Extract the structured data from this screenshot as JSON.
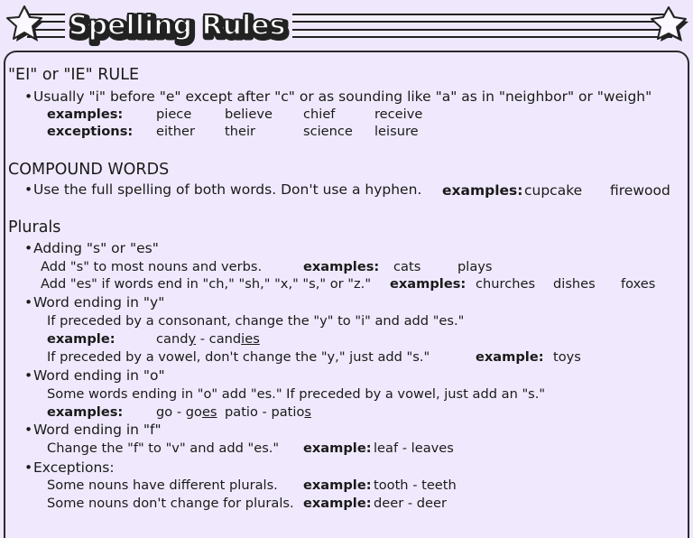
{
  "title": "Spelling Rules",
  "colors": {
    "background": "#efe8fc",
    "panel": "#f0e9fd",
    "ink": "#1a1a1a"
  },
  "sections": {
    "ei_ie": {
      "heading": "\"EI\" or \"IE\" RULE",
      "rule": "Usually \"i\" before \"e\" except after \"c\" or as sounding like \"a\" as in \"neighbor\" or \"weigh\"",
      "examples_label": "examples:",
      "examples": [
        "piece",
        "believe",
        "chief",
        "receive"
      ],
      "exceptions_label": "exceptions:",
      "exceptions": [
        "either",
        "their",
        "science",
        "leisure"
      ]
    },
    "compound": {
      "heading": "COMPOUND WORDS",
      "rule": "Use the full spelling of both words. Don't use a hyphen.",
      "examples_label": "examples:",
      "examples": [
        "cupcake",
        "firewood"
      ]
    },
    "plurals": {
      "heading": "Plurals",
      "adding": {
        "title": "Adding \"s\" or \"es\"",
        "rule1": "Add \"s\" to most nouns and verbs.",
        "rule1_label": "examples:",
        "rule1_examples": [
          "cats",
          "plays"
        ],
        "rule2": "Add \"es\" if words end in \"ch,\" \"sh,\" \"x,\" \"s,\" or \"z.\"",
        "rule2_label": "examples:",
        "rule2_examples": [
          "churches",
          "dishes",
          "foxes"
        ]
      },
      "ending_y": {
        "title": "Word ending in \"y\"",
        "rule1": "If preceded by a consonant, change the \"y\" to \"i\" and add \"es.\"",
        "example_label": "example:",
        "example_parts": [
          "cand",
          "y",
          " - cand",
          "ies"
        ],
        "rule2": "If preceded by a vowel, don't change the \"y,\" just add \"s.\"",
        "rule2_label": "example:",
        "rule2_example": "toys"
      },
      "ending_o": {
        "title": "Word ending in \"o\"",
        "rule": "Some words ending in \"o\" add \"es.\" If preceded by a vowel, just add an \"s.\"",
        "examples_label": "examples:",
        "example1_parts": [
          "go - go",
          "es"
        ],
        "example2_parts": [
          "patio - patio",
          "s"
        ]
      },
      "ending_f": {
        "title": "Word ending in \"f\"",
        "rule": "Change the \"f\" to \"v\" and add \"es.\"",
        "example_label": "example:",
        "example": "leaf - leaves"
      },
      "exceptions": {
        "title": "Exceptions:",
        "rule1": "Some nouns have different plurals.",
        "rule1_label": "example:",
        "rule1_example": "tooth - teeth",
        "rule2": "Some nouns don't change for plurals.",
        "rule2_label": "example:",
        "rule2_example": "deer - deer"
      }
    }
  },
  "bullet": "•"
}
